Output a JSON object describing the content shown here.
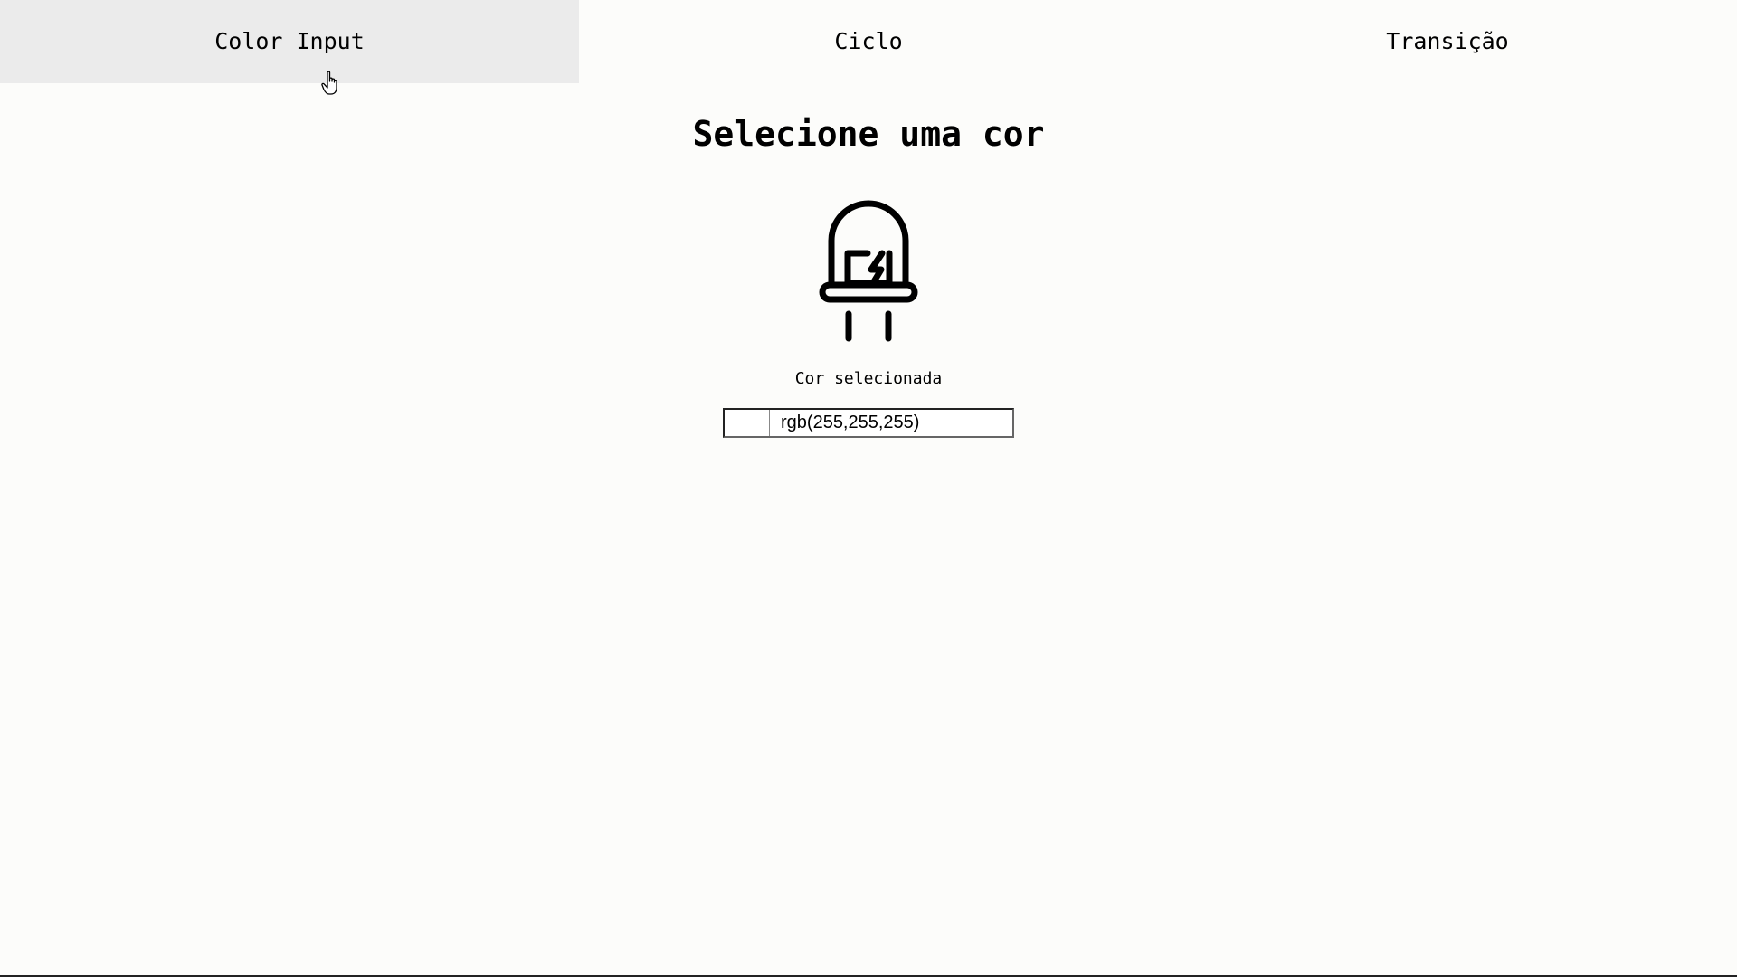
{
  "nav": {
    "tabs": [
      {
        "label": "Color Input"
      },
      {
        "label": "Ciclo"
      },
      {
        "label": "Transição"
      }
    ]
  },
  "main": {
    "title": "Selecione uma cor",
    "label": "Cor selecionada",
    "color_value": "rgb(255,255,255)",
    "swatch_color": "#ffffff",
    "led_icon": "led-icon"
  },
  "colors": {
    "background": "#fcfcfa",
    "active_tab": "#ebebeb",
    "text": "#000000"
  }
}
